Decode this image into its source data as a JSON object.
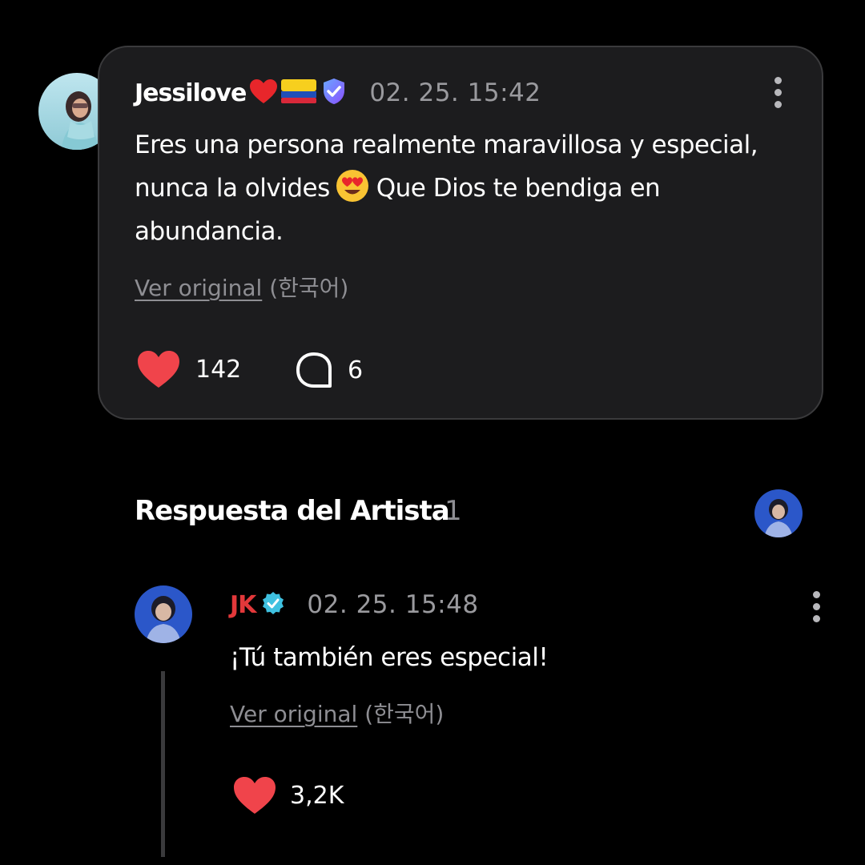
{
  "comment": {
    "username": "Jessilove",
    "timestamp": "02. 25. 15:42",
    "text_part1": "Eres una persona realmente maravillosa y especial, nunca la olvides",
    "text_part2": "Que Dios te bendiga en abundancia.",
    "emoji": "heart-eyes",
    "translate_link": "Ver original",
    "translate_lang": "(한국어)",
    "likes": "142",
    "replies": "6",
    "badges": [
      "red-heart-icon",
      "colombia-flag-icon",
      "verified-shield-icon"
    ]
  },
  "artist_section": {
    "title": "Respuesta del Artista",
    "count": "1"
  },
  "reply": {
    "username": "JK",
    "timestamp": "02. 25. 15:48",
    "text": "¡Tú también eres especial!",
    "translate_link": "Ver original",
    "translate_lang": "(한국어)",
    "likes": "3,2K"
  },
  "colors": {
    "background": "#000000",
    "card": "#1c1c1e",
    "like_heart": "#f0444b",
    "artist_name": "#e3383a",
    "verified_badge": "#3fc1e0"
  }
}
